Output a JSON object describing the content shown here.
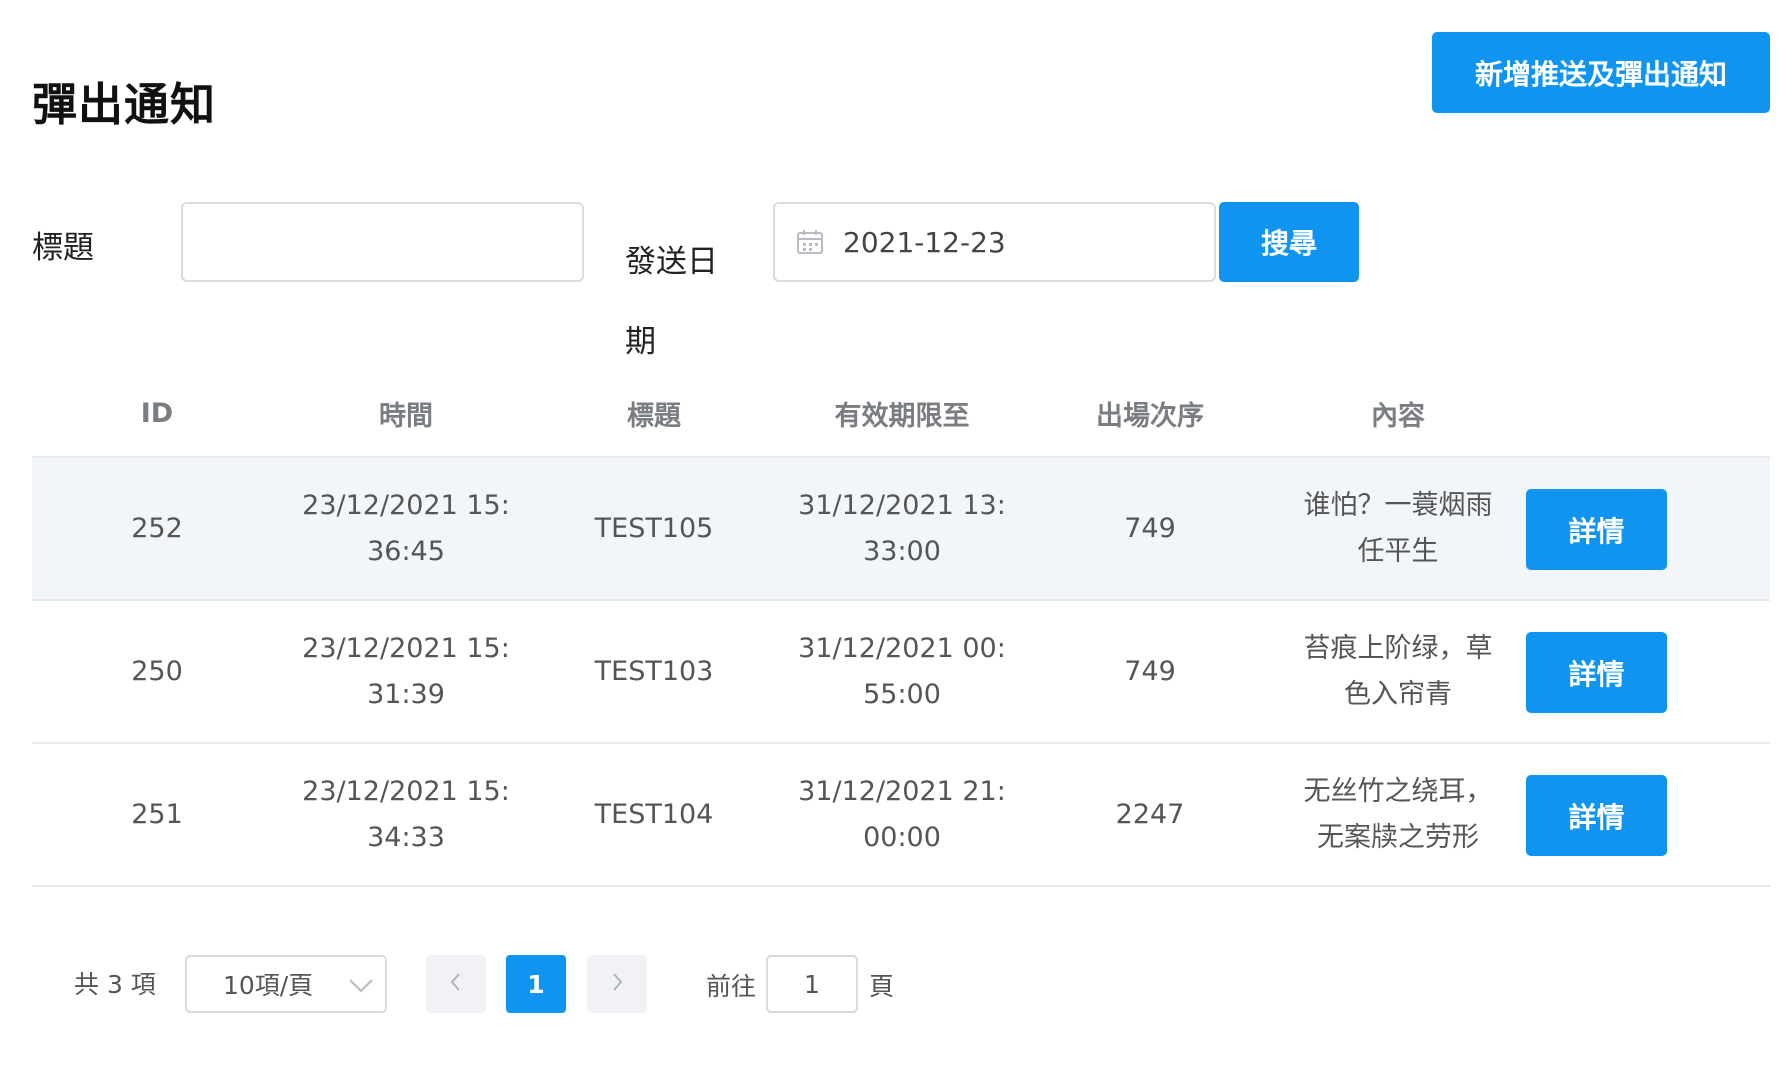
{
  "header": {
    "title": "彈出通知",
    "add_button_label": "新增推送及彈出通知"
  },
  "filters": {
    "title_label": "標題",
    "title_value": "",
    "date_label": "發送日期",
    "date_value": "2021-12-23",
    "search_label": "搜尋"
  },
  "table": {
    "headers": [
      "ID",
      "時間",
      "標題",
      "有效期限至",
      "出場次序",
      "內容"
    ],
    "rows": [
      {
        "id": "252",
        "time": [
          "23/12/2021 15:",
          "36:45"
        ],
        "title": "TEST105",
        "expiry": [
          "31/12/2021 13:",
          "33:00"
        ],
        "order": "749",
        "content": [
          "谁怕？一蓑烟雨",
          "任平生"
        ],
        "action": "詳情"
      },
      {
        "id": "250",
        "time": [
          "23/12/2021 15:",
          "31:39"
        ],
        "title": "TEST103",
        "expiry": [
          "31/12/2021 00:",
          "55:00"
        ],
        "order": "749",
        "content": [
          "苔痕上阶绿，草",
          "色入帘青"
        ],
        "action": "詳情"
      },
      {
        "id": "251",
        "time": [
          "23/12/2021 15:",
          "34:33"
        ],
        "title": "TEST104",
        "expiry": [
          "31/12/2021 21:",
          "00:00"
        ],
        "order": "2247",
        "content": [
          "无丝竹之绕耳，",
          "无案牍之劳形"
        ],
        "action": "詳情"
      }
    ]
  },
  "pagination": {
    "total_text": "共 3 項",
    "page_size": "10項/頁",
    "current_page": "1",
    "goto_label": "前往",
    "goto_value": "1",
    "goto_suffix": "頁"
  },
  "colors": {
    "primary": "#0f94f0",
    "hover_row": "#f3f6f9"
  },
  "icons": [
    "calendar-icon",
    "chevron-down-icon",
    "chevron-left-icon",
    "chevron-right-icon"
  ]
}
